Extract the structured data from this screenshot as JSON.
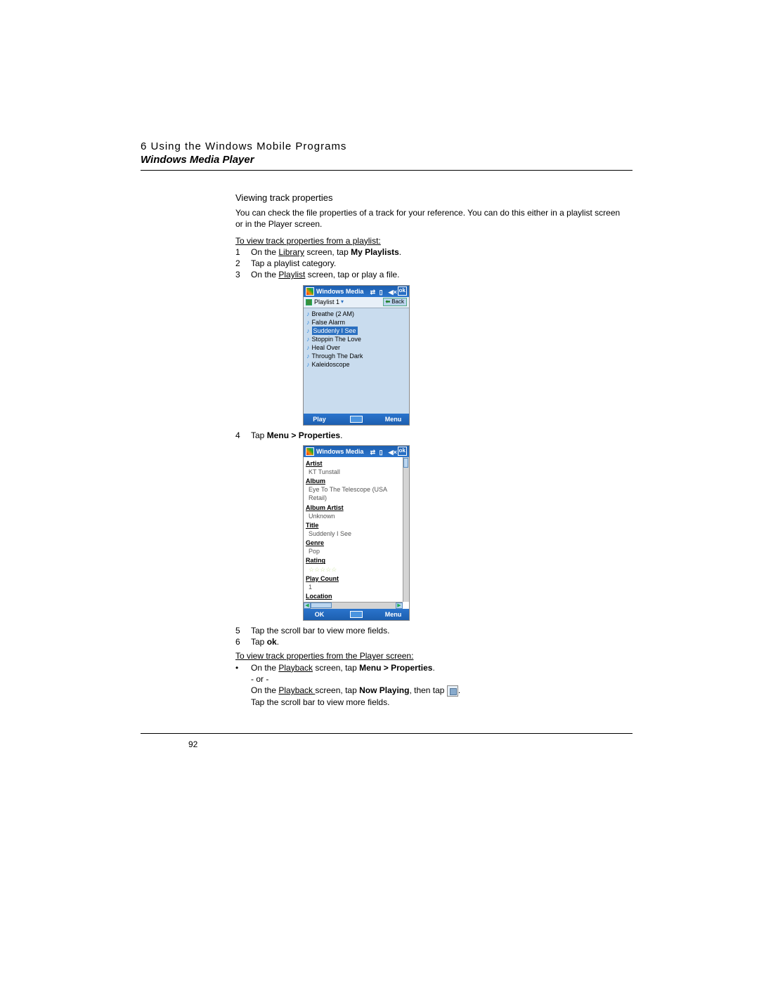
{
  "chapter": {
    "num_title": "6 Using the Windows Mobile Programs",
    "subtitle": "Windows Media Player"
  },
  "section": {
    "heading": "Viewing track properties",
    "intro": "You can check the file properties of a track for your reference. You can do this either in a playlist screen or in the Player screen.",
    "proc1_title": "To view track properties from a playlist:",
    "steps1": {
      "s1n": "1",
      "s1a": "On the ",
      "s1link": "Library",
      "s1b": " screen, tap ",
      "s1bold": "My Playlists",
      "s1c": ".",
      "s2n": "2",
      "s2t": "Tap a playlist category.",
      "s3n": "3",
      "s3a": "On the ",
      "s3link": "Playlist",
      "s3b": " screen, tap or play a file."
    },
    "step4": {
      "n": "4",
      "a": "Tap ",
      "bold": "Menu > Properties",
      "b": "."
    },
    "step5": {
      "n": "5",
      "t": "Tap the scroll bar to view more fields."
    },
    "step6": {
      "n": "6",
      "a": "Tap ",
      "bold": "ok",
      "b": "."
    },
    "proc2_title": "To view track properties from the Player screen:",
    "b1": {
      "bul": "•",
      "a": "On the ",
      "link": "Playback",
      "b": " screen, tap ",
      "bold": "Menu > Properties",
      "c": ".",
      "or": "- or -",
      "d": "On the ",
      "link2": "Playback ",
      "e": "screen, tap ",
      "bold2": "Now Playing",
      "f": ", then tap ",
      "g": ".",
      "h": "Tap the scroll bar to view more fields."
    }
  },
  "screenshot1": {
    "title": "Windows Media",
    "ok": "ok",
    "playlist_label": "Playlist 1",
    "back": "Back",
    "tracks": [
      "Breathe (2 AM)",
      "False Alarm",
      "Suddenly I See",
      "Stoppin The Love",
      "Heal Over",
      "Through The Dark",
      "Kaleidoscope"
    ],
    "selected_index": 2,
    "play": "Play",
    "menu": "Menu"
  },
  "screenshot2": {
    "title": "Windows Media",
    "ok": "ok",
    "fields": [
      {
        "label": "Artist",
        "value": "KT Tunstall"
      },
      {
        "label": "Album",
        "value": "Eye To The Telescope (USA Retail)"
      },
      {
        "label": "Album Artist",
        "value": "Unknown"
      },
      {
        "label": "Title",
        "value": "Suddenly I See"
      },
      {
        "label": "Genre",
        "value": "Pop"
      },
      {
        "label": "Rating",
        "value": "☆☆☆☆☆"
      },
      {
        "label": "Play Count",
        "value": "1"
      },
      {
        "label": "Location",
        "value": ""
      }
    ],
    "ok_btn": "OK",
    "menu": "Menu"
  },
  "page_number": "92"
}
